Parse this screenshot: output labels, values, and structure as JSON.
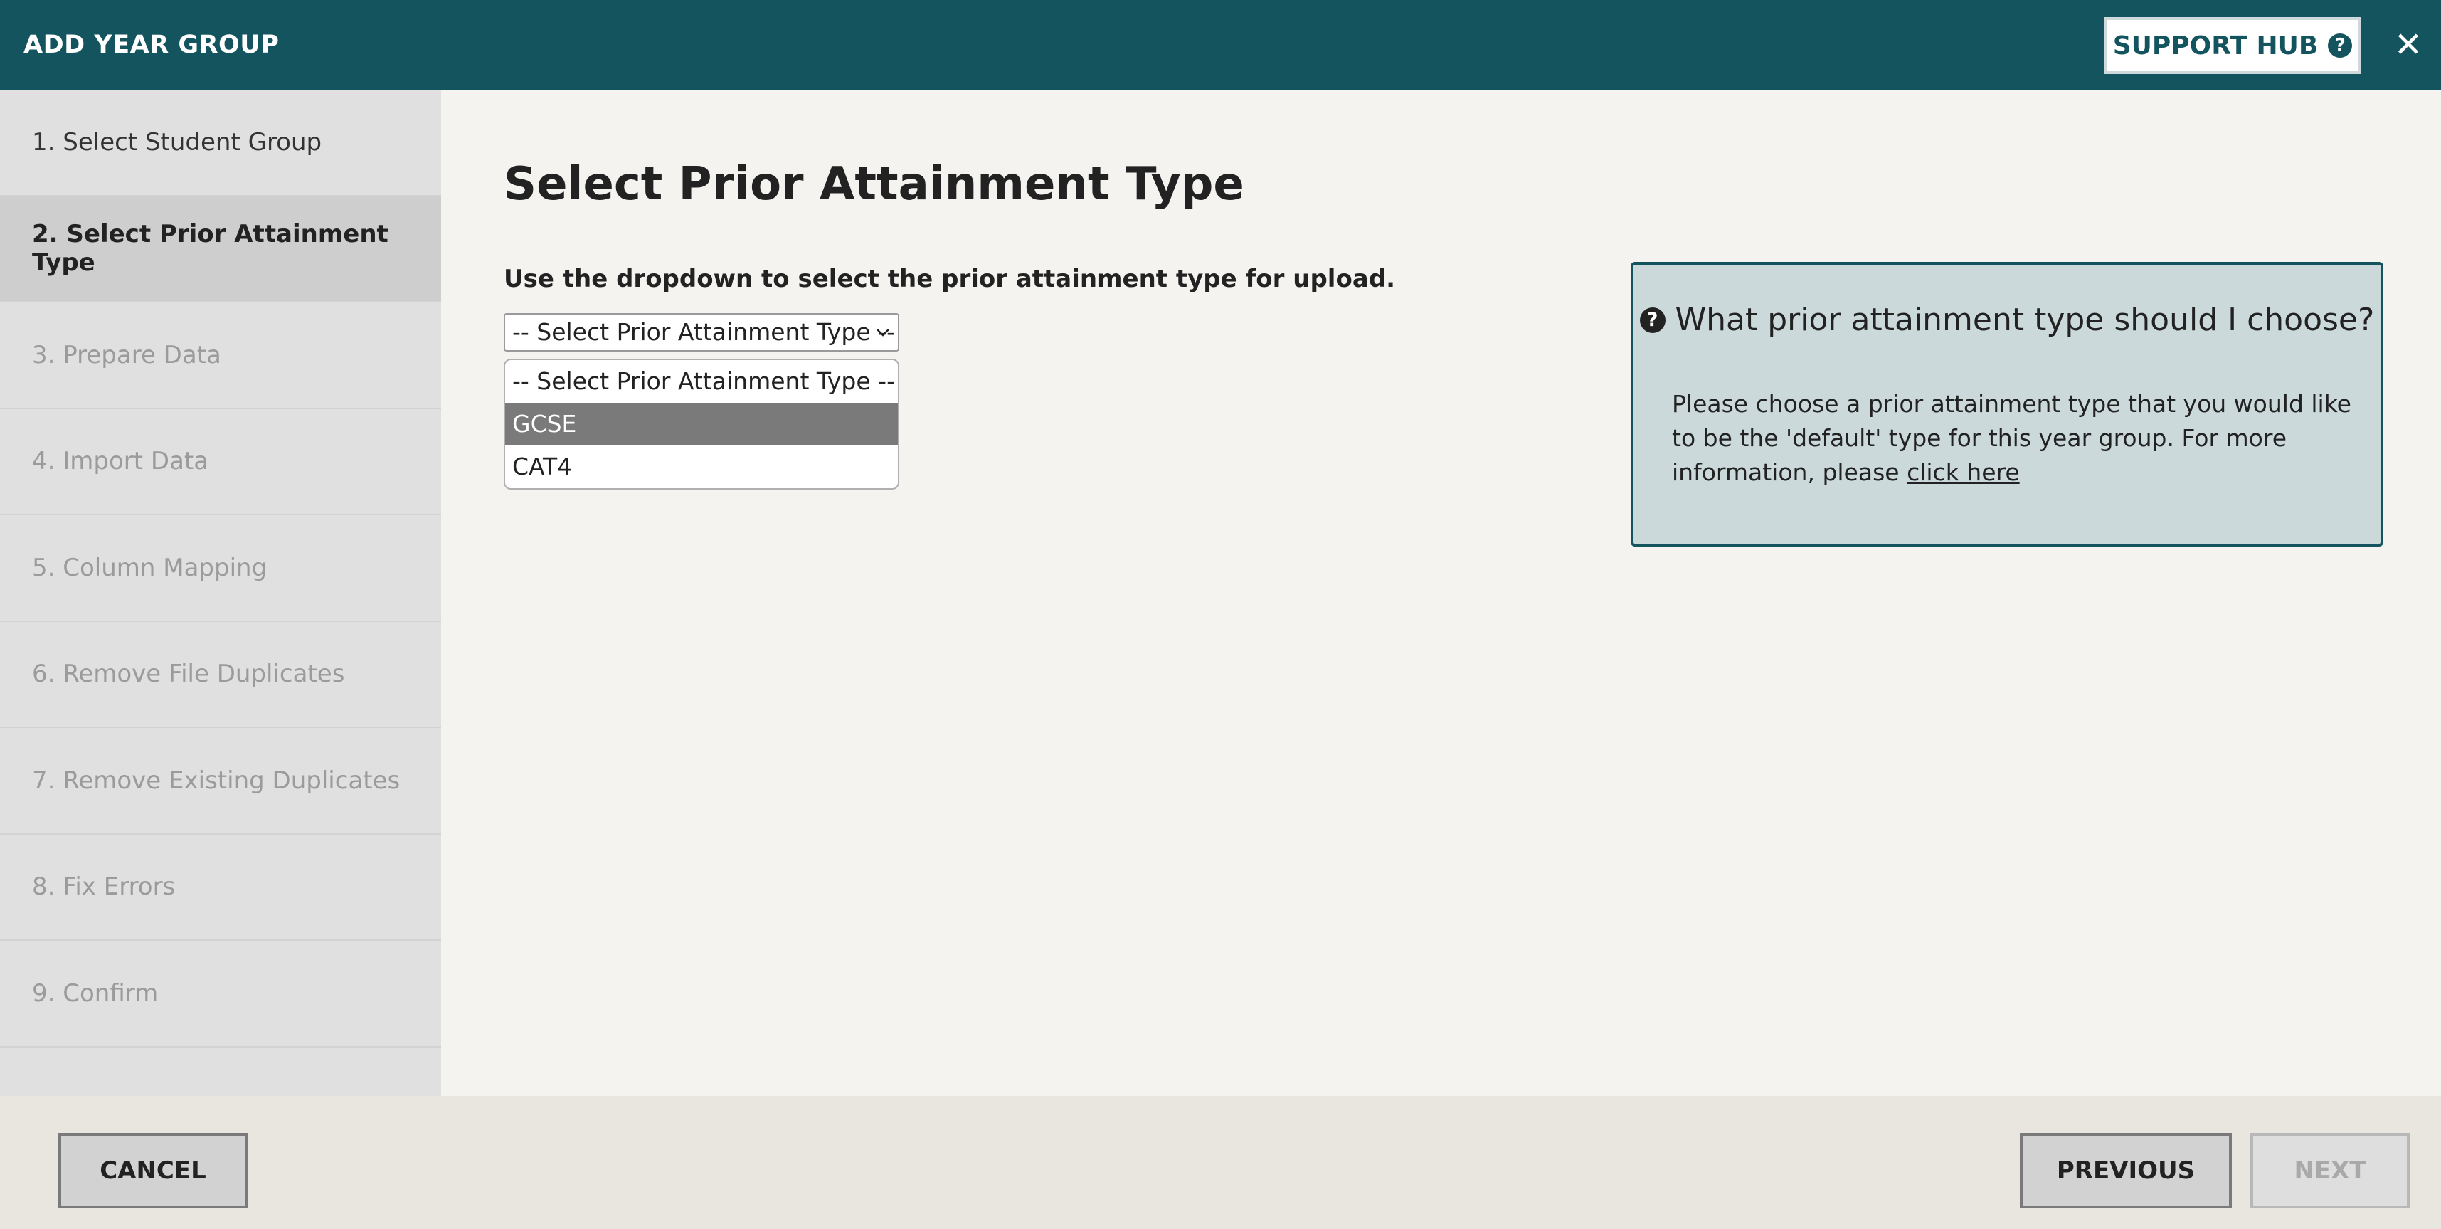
{
  "header": {
    "title": "ADD YEAR GROUP",
    "support_label": "SUPPORT HUB",
    "support_icon": "question-circle-icon",
    "close_glyph": "✕"
  },
  "sidebar": {
    "steps": [
      {
        "label": "1. Select Student Group",
        "state": "done"
      },
      {
        "label": "2. Select Prior Attainment Type",
        "state": "active"
      },
      {
        "label": "3. Prepare Data",
        "state": "disabled"
      },
      {
        "label": "4. Import Data",
        "state": "disabled"
      },
      {
        "label": "5. Column Mapping",
        "state": "disabled"
      },
      {
        "label": "6. Remove File Duplicates",
        "state": "disabled"
      },
      {
        "label": "7. Remove Existing Duplicates",
        "state": "disabled"
      },
      {
        "label": "8. Fix Errors",
        "state": "disabled"
      },
      {
        "label": "9. Confirm",
        "state": "disabled"
      }
    ]
  },
  "main": {
    "title": "Select Prior Attainment Type",
    "instruction": "Use the dropdown to select the prior attainment type for upload.",
    "select": {
      "selected": "-- Select Prior Attainment Type --",
      "options": [
        {
          "label": "-- Select Prior Attainment Type --",
          "highlighted": false
        },
        {
          "label": "GCSE",
          "highlighted": true
        },
        {
          "label": "CAT4",
          "highlighted": false
        }
      ]
    },
    "info": {
      "heading": "What prior attainment type should I choose?",
      "text": "Please choose a prior attainment type that you would like to be the 'default' type for this year group. For more information, please",
      "link": "click here"
    }
  },
  "footer": {
    "cancel_label": "CANCEL",
    "previous_label": "PREVIOUS",
    "next_label": "NEXT"
  },
  "colors": {
    "header_bg": "#13545e",
    "sidebar_bg": "#e0e0e0",
    "active_step_bg": "#cecece",
    "info_bg": "#cbd9db",
    "highlight_option": "#7a7a7a"
  }
}
